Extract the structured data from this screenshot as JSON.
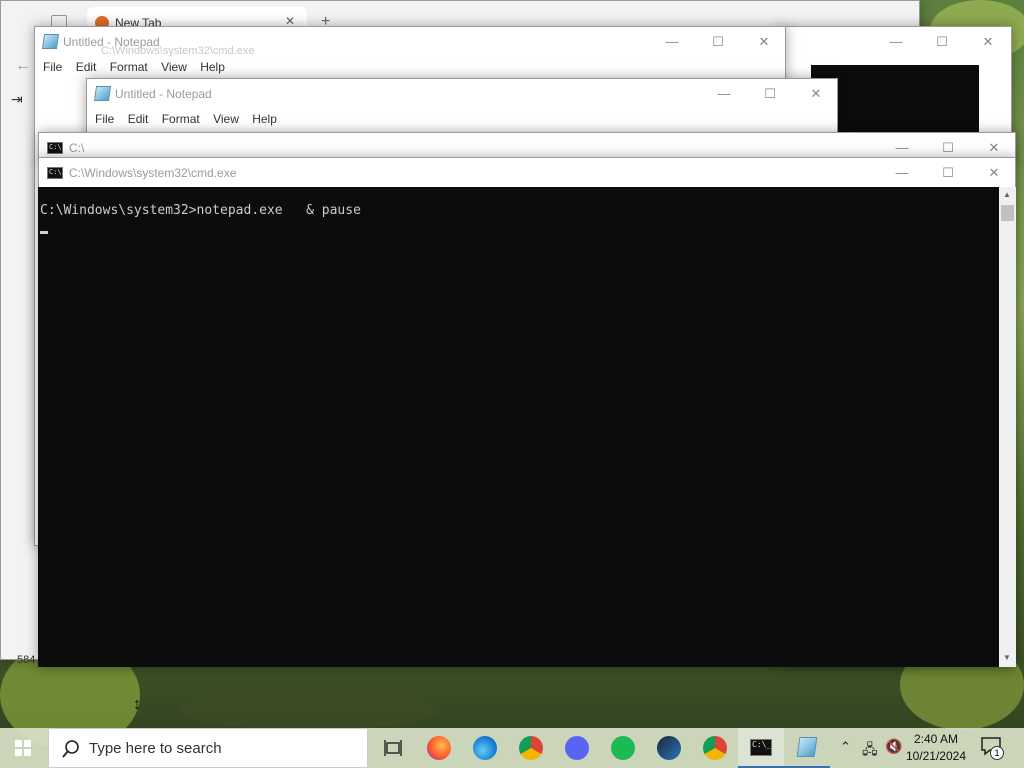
{
  "browser": {
    "tab_title": "New Tab",
    "page_counter": "584"
  },
  "notepad_back": {
    "title": "Untitled - Notepad",
    "behind_title": "C:\\Windows\\system32\\cmd.exe",
    "menu": [
      "File",
      "Edit",
      "Format",
      "View",
      "Help"
    ]
  },
  "notepad_front": {
    "title": "Untitled - Notepad",
    "menu": [
      "File",
      "Edit",
      "Format",
      "View",
      "Help"
    ]
  },
  "cmd_back": {
    "title": "C:\\"
  },
  "cmd_front": {
    "title": "C:\\Windows\\system32\\cmd.exe",
    "line1": "C:\\Windows\\system32>notepad.exe   & pause"
  },
  "window_controls": {
    "minimize": "—",
    "maximize": "☐",
    "close": "✕"
  },
  "taskbar": {
    "search_placeholder": "Type here to search",
    "time": "2:40 AM",
    "date": "10/21/2024",
    "notification_count": "1",
    "apps": [
      "task-view",
      "firefox",
      "edge",
      "chrome",
      "discord",
      "spotify",
      "steam",
      "chrome",
      "cmd",
      "notepad"
    ]
  },
  "colors": {
    "console_bg": "#0c0c0c",
    "console_text": "#cccccc",
    "taskbar_bg": "#d8e2c8"
  }
}
